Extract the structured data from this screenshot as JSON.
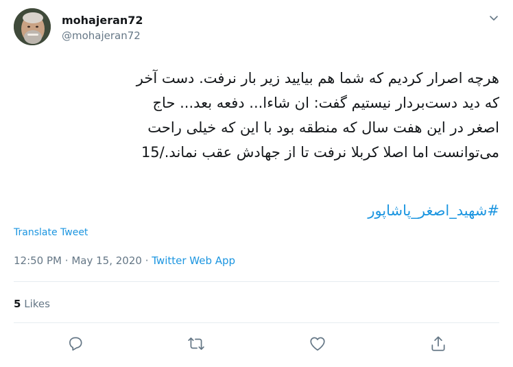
{
  "user": {
    "display_name": "mohajeran72",
    "handle": "@mohajeran72"
  },
  "tweet": {
    "lines": [
      "هرچه اصرار کردیم که شما هم بیایید زیر بار نرفت. دست آخر",
      "که دید دست‌بردار نیستیم گفت: ان شاءا... دفعه بعد... حاج",
      "اصغر در این هفت سال که منطقه بود با این که خیلی راحت",
      "می‌توانست اما اصلا کربلا نرفت تا از جهادش عقب نماند./15"
    ],
    "hashtag": "#شهید_اصغر_پاشاپور",
    "translate_label": "Translate Tweet",
    "time": "12:50 PM",
    "separator": "·",
    "date": "May 15, 2020",
    "source": "Twitter Web App"
  },
  "stats": {
    "likes_count": "5",
    "likes_label": "Likes"
  },
  "icons": {
    "caret": "chevron-down-icon",
    "reply": "reply-icon",
    "retweet": "retweet-icon",
    "like": "heart-icon",
    "share": "share-icon"
  },
  "colors": {
    "link": "#1b95e0",
    "secondary_text": "#657786",
    "icon": "#657786"
  }
}
